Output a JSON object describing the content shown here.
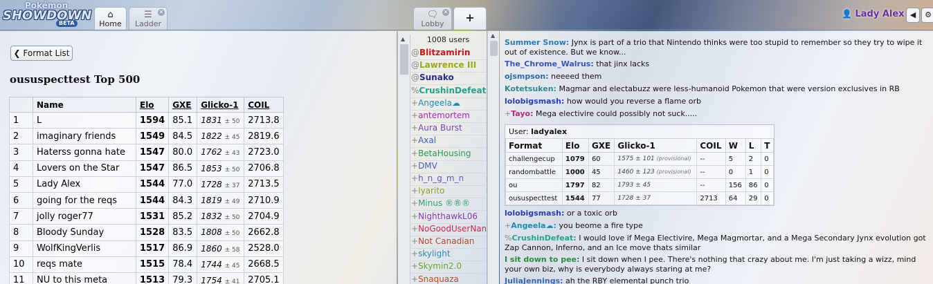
{
  "header": {
    "logo": {
      "line1": "Pokémon",
      "line2": "SHOWDOWN",
      "badge": "BETA"
    },
    "tabs": [
      {
        "label": "Home",
        "icon": "home-icon"
      },
      {
        "label": "Ladder",
        "icon": "list-icon"
      },
      {
        "label": "Lobby",
        "icon": "chat-bubble-icon"
      }
    ],
    "user_name": "Lady Alex"
  },
  "ladder": {
    "format_list_label": "Format List",
    "title": "oususpecttest Top 500",
    "columns": [
      "",
      "Name",
      "Elo",
      "GXE",
      "Glicko-1",
      "COIL"
    ],
    "rows": [
      {
        "rank": "1",
        "name": "L",
        "elo": "1594",
        "gxe": "85.1",
        "glicko": "1831",
        "dev": "± 50",
        "coil": "2713.8"
      },
      {
        "rank": "2",
        "name": "imaginary friends",
        "elo": "1549",
        "gxe": "84.5",
        "glicko": "1822",
        "dev": "± 45",
        "coil": "2819.6"
      },
      {
        "rank": "3",
        "name": "Haterss gonna hate",
        "elo": "1547",
        "gxe": "80.0",
        "glicko": "1762",
        "dev": "± 43",
        "coil": "2723.0"
      },
      {
        "rank": "4",
        "name": "Lovers on the Star",
        "elo": "1547",
        "gxe": "86.5",
        "glicko": "1853",
        "dev": "± 50",
        "coil": "2706.8"
      },
      {
        "rank": "5",
        "name": "Lady Alex",
        "elo": "1544",
        "gxe": "77.0",
        "glicko": "1728",
        "dev": "± 37",
        "coil": "2713.5"
      },
      {
        "rank": "6",
        "name": "going for the reqs",
        "elo": "1544",
        "gxe": "84.3",
        "glicko": "1819",
        "dev": "± 49",
        "coil": "2710.9"
      },
      {
        "rank": "7",
        "name": "jolly roger77",
        "elo": "1531",
        "gxe": "85.2",
        "glicko": "1832",
        "dev": "± 50",
        "coil": "2704.9"
      },
      {
        "rank": "8",
        "name": "Bloody Sunday",
        "elo": "1528",
        "gxe": "83.5",
        "glicko": "1808",
        "dev": "± 50",
        "coil": "2662.8"
      },
      {
        "rank": "9",
        "name": "WolfKingVerlis",
        "elo": "1517",
        "gxe": "86.9",
        "glicko": "1860",
        "dev": "± 58",
        "coil": "2528.0"
      },
      {
        "rank": "10",
        "name": "reqs mate",
        "elo": "1515",
        "gxe": "78.4",
        "glicko": "1744",
        "dev": "± 45",
        "coil": "2668.5"
      },
      {
        "rank": "11",
        "name": "NU to this meta",
        "elo": "1513",
        "gxe": "79.3",
        "glicko": "1754",
        "dev": "± 41",
        "coil": "2705.1"
      }
    ]
  },
  "userlist": {
    "count": "1008 users",
    "users": [
      {
        "group": "@",
        "name": "Blitzamirin",
        "color": "#c8161c",
        "bold": true
      },
      {
        "group": "@",
        "name": "Lawrence III",
        "color": "#9aa81e",
        "bold": true
      },
      {
        "group": "@",
        "name": "Sunako",
        "color": "#2a2a8e",
        "bold": true
      },
      {
        "group": "%",
        "name": "CrushinDefeat",
        "color": "#28a088",
        "bold": true
      },
      {
        "group": "+",
        "name": "Angeela☁",
        "color": "#1e8ab4",
        "bold": false
      },
      {
        "group": "+",
        "name": "antemortem",
        "color": "#a22ab4",
        "bold": false
      },
      {
        "group": "+",
        "name": "Aura Burst",
        "color": "#7a42c0",
        "bold": false
      },
      {
        "group": "+",
        "name": "Axal",
        "color": "#3a62c4",
        "bold": false
      },
      {
        "group": "+",
        "name": "BetaHousing",
        "color": "#2a9a4a",
        "bold": false
      },
      {
        "group": "+",
        "name": "DMV",
        "color": "#4a58c8",
        "bold": false
      },
      {
        "group": "+",
        "name": "h_n_g_m_n",
        "color": "#6a52c4",
        "bold": false
      },
      {
        "group": "+",
        "name": "Iyarito",
        "color": "#88a020",
        "bold": false
      },
      {
        "group": "+",
        "name": "Minus ®®®",
        "color": "#30a070",
        "bold": false
      },
      {
        "group": "+",
        "name": "NighthawkL06",
        "color": "#8a3ab8",
        "bold": false
      },
      {
        "group": "+",
        "name": "NoGoodUserName",
        "color": "#c02a52",
        "bold": false
      },
      {
        "group": "+",
        "name": "Not Canadian",
        "color": "#b0482a",
        "bold": false
      },
      {
        "group": "+",
        "name": "skylight",
        "color": "#2a8ab0",
        "bold": false
      },
      {
        "group": "+",
        "name": "Skymin2.0",
        "color": "#62a82a",
        "bold": false
      },
      {
        "group": "+",
        "name": "Snaquaza",
        "color": "#c04a28",
        "bold": false
      }
    ]
  },
  "chat": {
    "messages_before": [
      {
        "group": "",
        "name": "Summer Snow:",
        "color": "#2a7ab8",
        "text": "Jynx is part of a trio that Nintendo thinks were too stupid to remember so they try to wipe it out of existence. But we know...",
        "lines": 2
      },
      {
        "group": "",
        "name": "The_Chrome_Walrus:",
        "color": "#3a52b8",
        "text": "that jinx lacks",
        "lines": 1
      },
      {
        "group": "",
        "name": "ojsmpson:",
        "color": "#2a6ab0",
        "text": "neeeed them",
        "lines": 1
      },
      {
        "group": "",
        "name": "Kotetsuken:",
        "color": "#2a8a8a",
        "text": "Magmar and electabuzz were less-humanoid Pokemon that were version exclusives in RB",
        "lines": 1
      },
      {
        "group": "",
        "name": "lolobigsmash:",
        "color": "#2a3ab0",
        "text": "how would you reverse a flame orb",
        "lines": 1
      },
      {
        "group": "+",
        "name": "Tayo:",
        "color": "#b02a7a",
        "text": "Mega electivire could possibly not suck.....",
        "lines": 1
      }
    ],
    "userlist_box": {
      "user_label": "User:",
      "user_value": "ladyalex",
      "columns": [
        "Format",
        "Elo",
        "GXE",
        "Glicko-1",
        "COIL",
        "W",
        "L",
        "T"
      ],
      "rows": [
        {
          "format": "challengecup",
          "elo": "1079",
          "gxe": "60",
          "glicko": "1575 ± 101",
          "prov": "(provisional)",
          "coil": "--",
          "w": "5",
          "l": "2",
          "t": "0"
        },
        {
          "format": "randombattle",
          "elo": "1000",
          "gxe": "45",
          "glicko": "1460 ± 123",
          "prov": "(provisional)",
          "coil": "--",
          "w": "0",
          "l": "1",
          "t": "0"
        },
        {
          "format": "ou",
          "elo": "1797",
          "gxe": "82",
          "glicko": "1793 ± 45",
          "prov": "",
          "coil": "--",
          "w": "156",
          "l": "86",
          "t": "0"
        },
        {
          "format": "oususpecttest",
          "elo": "1544",
          "gxe": "77",
          "glicko": "1728 ± 37",
          "prov": "",
          "coil": "2713",
          "w": "64",
          "l": "29",
          "t": "0"
        }
      ]
    },
    "messages_after": [
      {
        "group": "",
        "name": "lolobigsmash:",
        "color": "#2a3ab0",
        "text": "or a toxic orb",
        "lines": 1
      },
      {
        "group": "+",
        "name": "Angeela☁:",
        "color": "#1e8ab4",
        "text": "you beome a fire type",
        "lines": 1
      },
      {
        "group": "%",
        "name": "CrushinDefeat:",
        "color": "#28a088",
        "text": "I would love if Mega Electivire, Mega Magmortar, and a Mega Secondary Jynx evolution got Zap Cannon, Inferno, and an Ice move thats similar",
        "lines": 2
      },
      {
        "group": "",
        "name": "I sit down to pee:",
        "color": "#2a8a3a",
        "text": "I sit down when I pee. There's nothing that crazy about me. I'm just taking a wizz, mind your own biz, why is everybody always staring at me?",
        "lines": 2
      },
      {
        "group": "",
        "name": "JuliaJennings:",
        "color": "#3a6ab0",
        "text": "ah the RBY elemental punch trio",
        "lines": 1
      }
    ]
  }
}
